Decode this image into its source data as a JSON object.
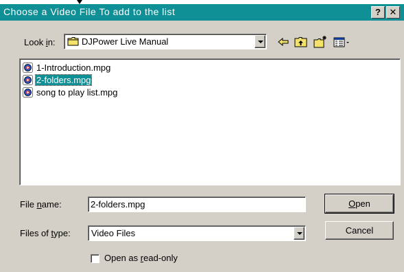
{
  "dialog": {
    "title": "Choose a Video File To add to the list",
    "help_label": "?",
    "close_label": "✕"
  },
  "look_in": {
    "label_pre": "Look ",
    "label_accel": "i",
    "label_post": "n:",
    "value": "DJPower Live Manual"
  },
  "toolbar": {
    "icons": [
      "back-arrow-icon",
      "up-one-level-icon",
      "create-new-folder-icon",
      "view-menu-icon"
    ]
  },
  "files": [
    {
      "name": "1-Introduction.mpg",
      "selected": false,
      "icon": "video-file-icon"
    },
    {
      "name": "2-folders.mpg",
      "selected": true,
      "icon": "video-file-icon"
    },
    {
      "name": "song to play list.mpg",
      "selected": false,
      "icon": "video-file-icon"
    }
  ],
  "file_name": {
    "label_pre": "File ",
    "label_accel": "n",
    "label_post": "ame:",
    "value": "2-folders.mpg"
  },
  "file_type": {
    "label_pre": "Files of ",
    "label_accel": "t",
    "label_post": "ype:",
    "value": "Video Files"
  },
  "buttons": {
    "open_accel": "O",
    "open_rest": "pen",
    "cancel": "Cancel"
  },
  "read_only": {
    "label_pre": "Open as ",
    "label_accel": "r",
    "label_post": "ead-only",
    "checked": false
  },
  "colors": {
    "titlebar": "#0f8f96",
    "face": "#d4d0c8",
    "selection": "#0f8f96"
  }
}
